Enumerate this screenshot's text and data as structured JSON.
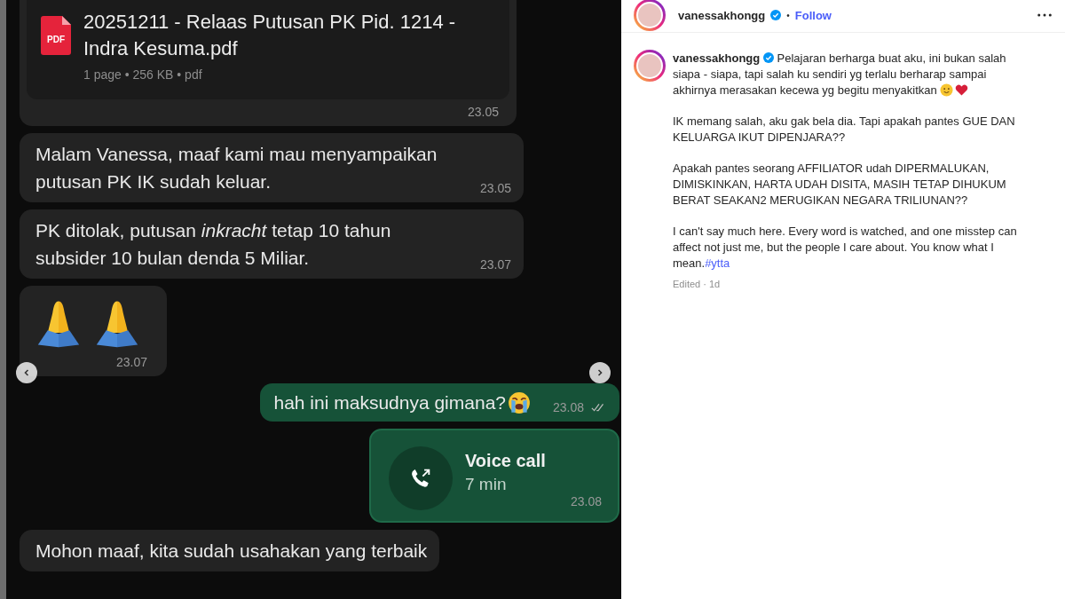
{
  "chat": {
    "messages": [
      {
        "kind": "document",
        "outgoing": false,
        "file_name": "20251211 - Relaas Putusan PK Pid. 1214 - Indra Kesuma.pdf",
        "file_type": "PDF",
        "meta": "1 page • 256 KB • pdf",
        "time": "23.05"
      },
      {
        "kind": "text",
        "outgoing": false,
        "text": "Malam Vanessa, maaf kami mau menyampaikan putusan PK IK sudah keluar.",
        "time": "23.05"
      },
      {
        "kind": "text",
        "outgoing": false,
        "text": "PK ditolak, putusan *inkracht* tetap 10 tahun subsider 10 bulan denda 5 Miliar.",
        "time": "23.07"
      },
      {
        "kind": "emoji",
        "outgoing": false,
        "time": "23.07"
      },
      {
        "kind": "text",
        "outgoing": true,
        "text": "hah ini maksudnya gimana?",
        "emoji_end": true,
        "read": true,
        "time": "23.08"
      },
      {
        "kind": "call",
        "outgoing": true,
        "title": "Voice call",
        "duration": "7 min",
        "time": "23.08"
      },
      {
        "kind": "text",
        "outgoing": false,
        "text": "Mohon maaf, kita sudah usahakan yang terbaik"
      }
    ]
  },
  "post": {
    "author": "vanessakhongg",
    "verified": true,
    "separator": "•",
    "follow": "Follow",
    "caption": {
      "author": "vanessakhongg",
      "paragraphs": [
        {
          "text": "Pelajaran berharga buat aku, ini bukan salah siapa - siapa, tapi salah ku sendiri yg terlalu berharap sampai akhirnya merasakan kecewa yg begitu menyakitkan",
          "emoji_end": true
        },
        {
          "text": "IK memang salah, aku gak bela dia. Tapi apakah pantes GUE DAN KELUARGA IKUT DIPENJARA??"
        },
        {
          "text": "Apakah pantes seorang AFFILIATOR udah DIPERMALUKAN, DIMISKINKAN, HARTA UDAH DISITA, MASIH TETAP DIHUKUM BERAT SEAKAN2 MERUGIKAN NEGARA TRILIUNAN??"
        },
        {
          "text": "I can't say much here. Every word is watched, and one misstep can affect not just me, but the people I care about. You know what I mean.",
          "hashtag": "#ytta"
        }
      ]
    },
    "edited": "Edited · 1d"
  }
}
